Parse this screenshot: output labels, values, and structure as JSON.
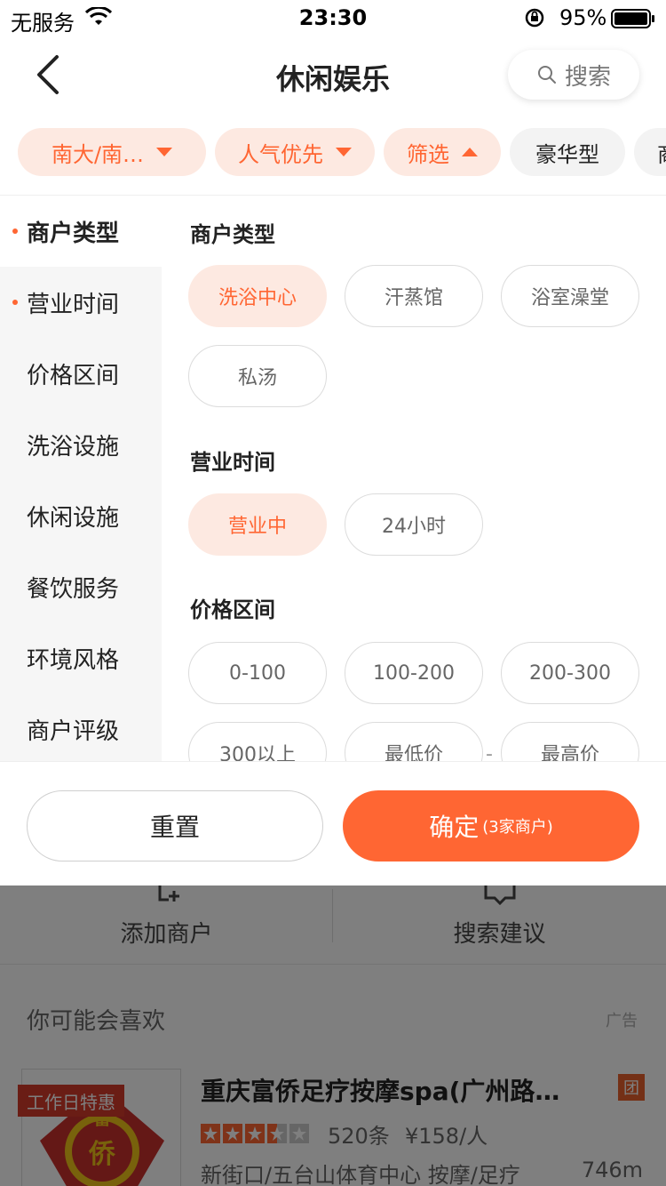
{
  "status_bar": {
    "carrier": "无服务",
    "time": "23:30",
    "battery_pct": "95%"
  },
  "nav": {
    "title": "休闲娱乐",
    "search_label": "搜索",
    "back_icon": "chevron-left-icon",
    "search_icon": "search-icon"
  },
  "chips": [
    {
      "label": "南大/南…",
      "state": "active",
      "arrow": "down"
    },
    {
      "label": "人气优先",
      "state": "active",
      "arrow": "down"
    },
    {
      "label": "筛选",
      "state": "active",
      "arrow": "up"
    },
    {
      "label": "豪华型",
      "state": "plain"
    },
    {
      "label": "商",
      "state": "plain"
    }
  ],
  "side_nav": [
    {
      "label": "商户类型",
      "current": true,
      "dot": true
    },
    {
      "label": "营业时间",
      "current": false,
      "dot": true
    },
    {
      "label": "价格区间",
      "current": false,
      "dot": false
    },
    {
      "label": "洗浴设施",
      "current": false,
      "dot": false
    },
    {
      "label": "休闲设施",
      "current": false,
      "dot": false
    },
    {
      "label": "餐饮服务",
      "current": false,
      "dot": false
    },
    {
      "label": "环境风格",
      "current": false,
      "dot": false
    },
    {
      "label": "商户评级",
      "current": false,
      "dot": false
    }
  ],
  "sections": {
    "merchant_type": {
      "title": "商户类型",
      "options": [
        {
          "label": "洗浴中心",
          "selected": true
        },
        {
          "label": "汗蒸馆",
          "selected": false
        },
        {
          "label": "浴室澡堂",
          "selected": false
        },
        {
          "label": "私汤",
          "selected": false
        }
      ]
    },
    "hours": {
      "title": "营业时间",
      "options": [
        {
          "label": "营业中",
          "selected": true
        },
        {
          "label": "24小时",
          "selected": false
        }
      ]
    },
    "price": {
      "title": "价格区间",
      "options": [
        {
          "label": "0-100",
          "selected": false
        },
        {
          "label": "100-200",
          "selected": false
        },
        {
          "label": "200-300",
          "selected": false
        },
        {
          "label": "300以上",
          "selected": false
        }
      ],
      "min_placeholder": "最低价",
      "max_placeholder": "最高价",
      "dash": "-"
    }
  },
  "actions": {
    "reset_label": "重置",
    "confirm_label": "确定",
    "confirm_sub": "(3家商户)"
  },
  "background": {
    "tools": [
      {
        "label": "添加商户",
        "icon": "add-merchant-icon"
      },
      {
        "label": "搜索建议",
        "icon": "suggestion-icon"
      }
    ],
    "guess_title": "你可能会喜欢",
    "ad_tag": "广告",
    "shop": {
      "promo_tag": "工作日特惠",
      "logo_text": "富侨",
      "name": "重庆富侨足疗按摩spa(广州路…",
      "tuan_badge": "团",
      "rating": 3.5,
      "reviews": "520条",
      "price": "¥158/人",
      "location": "新街口/五台山体育中心  按摩/足疗",
      "distance": "746m"
    }
  },
  "colors": {
    "accent": "#ff6633",
    "chip_active_bg": "#fde9e1",
    "overlay": "rgba(0,0,0,0.5)"
  }
}
